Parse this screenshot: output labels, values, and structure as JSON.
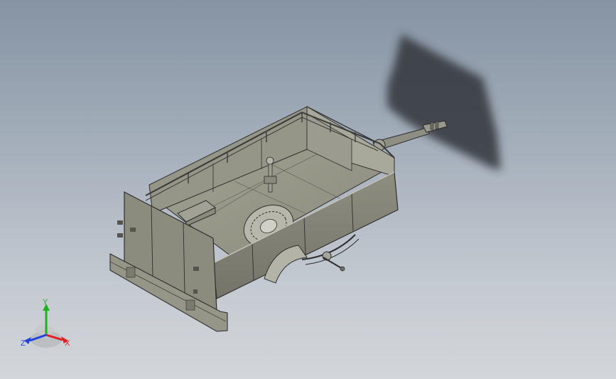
{
  "viewport": {
    "model": "trailer-assembly",
    "background_top": "#8593a3",
    "background_bottom": "#d3d6da",
    "body_color": "#8c8c7f",
    "edge_color": "#2e2e2e",
    "shadow_color": "#3a3d42"
  },
  "triad": {
    "x_label": "X",
    "y_label": "Y",
    "z_label": "Z",
    "x_color": "#e02020",
    "y_color": "#20b020",
    "z_color": "#2040e0"
  }
}
